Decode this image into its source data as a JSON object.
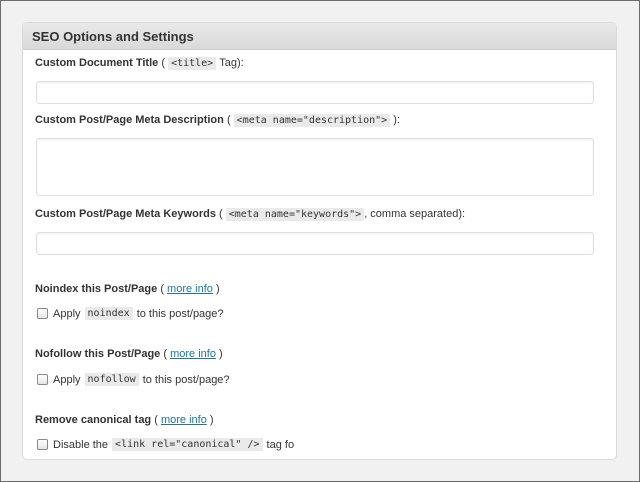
{
  "panel": {
    "title": "SEO Options and Settings"
  },
  "fields": {
    "title": {
      "label": "Custom Document Title",
      "paren_open": "(",
      "code": "<title>",
      "suffix": "Tag):",
      "value": ""
    },
    "description": {
      "label": "Custom Post/Page Meta Description",
      "paren_open": "(",
      "code": "<meta name=\"description\">",
      "suffix": "):",
      "value": ""
    },
    "keywords": {
      "label": "Custom Post/Page Meta Keywords",
      "paren_open": "(",
      "code": "<meta name=\"keywords\">",
      "suffix": ", comma separated):",
      "value": ""
    }
  },
  "noindex": {
    "label": "Noindex this Post/Page",
    "paren_open": "(",
    "link": "more info",
    "paren_close": ")",
    "checkbox_prefix": "Apply",
    "checkbox_code": "noindex",
    "checkbox_suffix": "to this post/page?",
    "checked": false
  },
  "nofollow": {
    "label": "Nofollow this Post/Page",
    "paren_open": "(",
    "link": "more info",
    "paren_close": ")",
    "checkbox_prefix": "Apply",
    "checkbox_code": "nofollow",
    "checkbox_suffix": "to this post/page?",
    "checked": false
  },
  "canonical": {
    "label": "Remove canonical tag",
    "paren_open": "(",
    "link": "more info",
    "paren_close": ")",
    "checkbox_prefix": "Disable the",
    "checkbox_code": "<link rel=\"canonical\" />",
    "checkbox_suffix": "tag fo",
    "checked": false
  }
}
